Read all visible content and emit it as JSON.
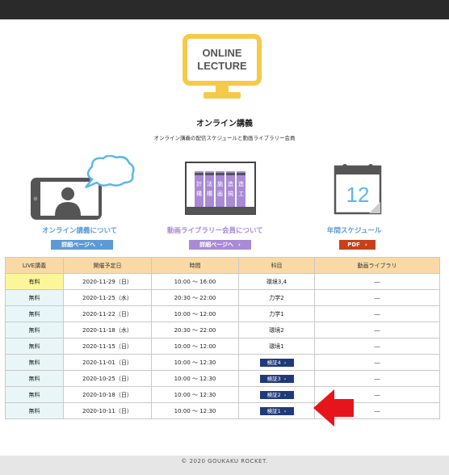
{
  "header": {
    "logo_line1": "ONLINE",
    "logo_line2": "LECTURE",
    "title": "オンライン講義",
    "subtitle": "オンライン講義の配信スケジュールと動画ライブラリー会員"
  },
  "features": [
    {
      "label": "オンライン講義について",
      "button": "詳細ページへ",
      "color": "#5b9bd5",
      "icon": "tablet-video-chat-icon"
    },
    {
      "label": "動画ライブラリー会員について",
      "button": "詳細ページへ",
      "color": "#a98ad6",
      "icon": "book-library-icon",
      "book_labels": [
        "計",
        "構",
        "法",
        "構",
        "施",
        "画",
        "造",
        "規",
        "造",
        "工"
      ]
    },
    {
      "label": "年間スケジュール",
      "button": "PDF",
      "color": "#5b9bd5",
      "button_color": "#c8401a",
      "icon": "calendar-icon",
      "calendar_number": "12"
    }
  ],
  "table": {
    "headers": [
      "LIVE講義",
      "開催予定日",
      "時間",
      "科目",
      "動画ライブラリ"
    ],
    "rows": [
      {
        "live": "有料",
        "date": "2020-11-29（日）",
        "time": "10:00 ～ 16:00",
        "subject": "環境3,4",
        "subject_button": false,
        "library": "―"
      },
      {
        "live": "無料",
        "date": "2020-11-25（水）",
        "time": "20:30 ～ 22:00",
        "subject": "力学2",
        "subject_button": false,
        "library": "―"
      },
      {
        "live": "無料",
        "date": "2020-11-22（日）",
        "time": "10:00 ～ 12:00",
        "subject": "力学1",
        "subject_button": false,
        "library": "―"
      },
      {
        "live": "無料",
        "date": "2020-11-18（水）",
        "time": "20:30 ～ 22:00",
        "subject": "環境2",
        "subject_button": false,
        "library": "―"
      },
      {
        "live": "無料",
        "date": "2020-11-15（日）",
        "time": "10:00 ～ 12:00",
        "subject": "環境1",
        "subject_button": false,
        "library": "―"
      },
      {
        "live": "無料",
        "date": "2020-11-01（日）",
        "time": "10:00 ～ 12:30",
        "subject": "検証4",
        "subject_button": true,
        "library": "―"
      },
      {
        "live": "無料",
        "date": "2020-10-25（日）",
        "time": "10:00 ～ 12:30",
        "subject": "検証3",
        "subject_button": true,
        "library": "―"
      },
      {
        "live": "無料",
        "date": "2020-10-18（日）",
        "time": "10:00 ～ 12:30",
        "subject": "検証2",
        "subject_button": true,
        "library": "―"
      },
      {
        "live": "無料",
        "date": "2020-10-11（日）",
        "time": "10:00 ～ 12:30",
        "subject": "検証1",
        "subject_button": true,
        "library": "―"
      }
    ]
  },
  "footer": {
    "copyright": "© 2020  GOUKAKU ROCKET."
  },
  "colors": {
    "logo_yellow": "#f6c94a",
    "header_orange": "#f9d9a6",
    "paid_yellow": "#fbf69a",
    "free_teal": "#e8f6f7",
    "subject_navy": "#1f3a7a",
    "arrow_red": "#e8141b"
  }
}
